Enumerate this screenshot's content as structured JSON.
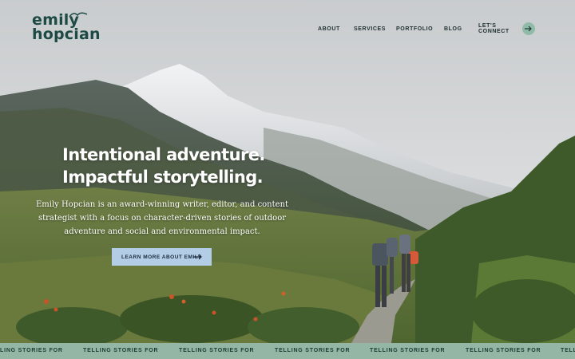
{
  "logo": {
    "line1": "emily",
    "line2": "hopcian"
  },
  "nav": {
    "items": [
      "ABOUT",
      "SERVICES",
      "PORTFOLIO",
      "BLOG",
      "LET'S CONNECT"
    ]
  },
  "hero": {
    "headline_line1": "Intentional adventure.",
    "headline_line2": "Impactful storytelling.",
    "intro": "Emily Hopcian is an award-winning writer, editor, and content strategist with a focus on character-driven stories of outdoor adventure and social and environmental impact.",
    "cta_label": "LEARN MORE ABOUT EMILY"
  },
  "ticker": {
    "text": "TELLING STORIES FOR",
    "first_partial": "LING STORIES FOR"
  },
  "colors": {
    "brand_dark": "#1d4a44",
    "accent_green": "#93b6a5",
    "cta_blue": "#b3cde6"
  }
}
